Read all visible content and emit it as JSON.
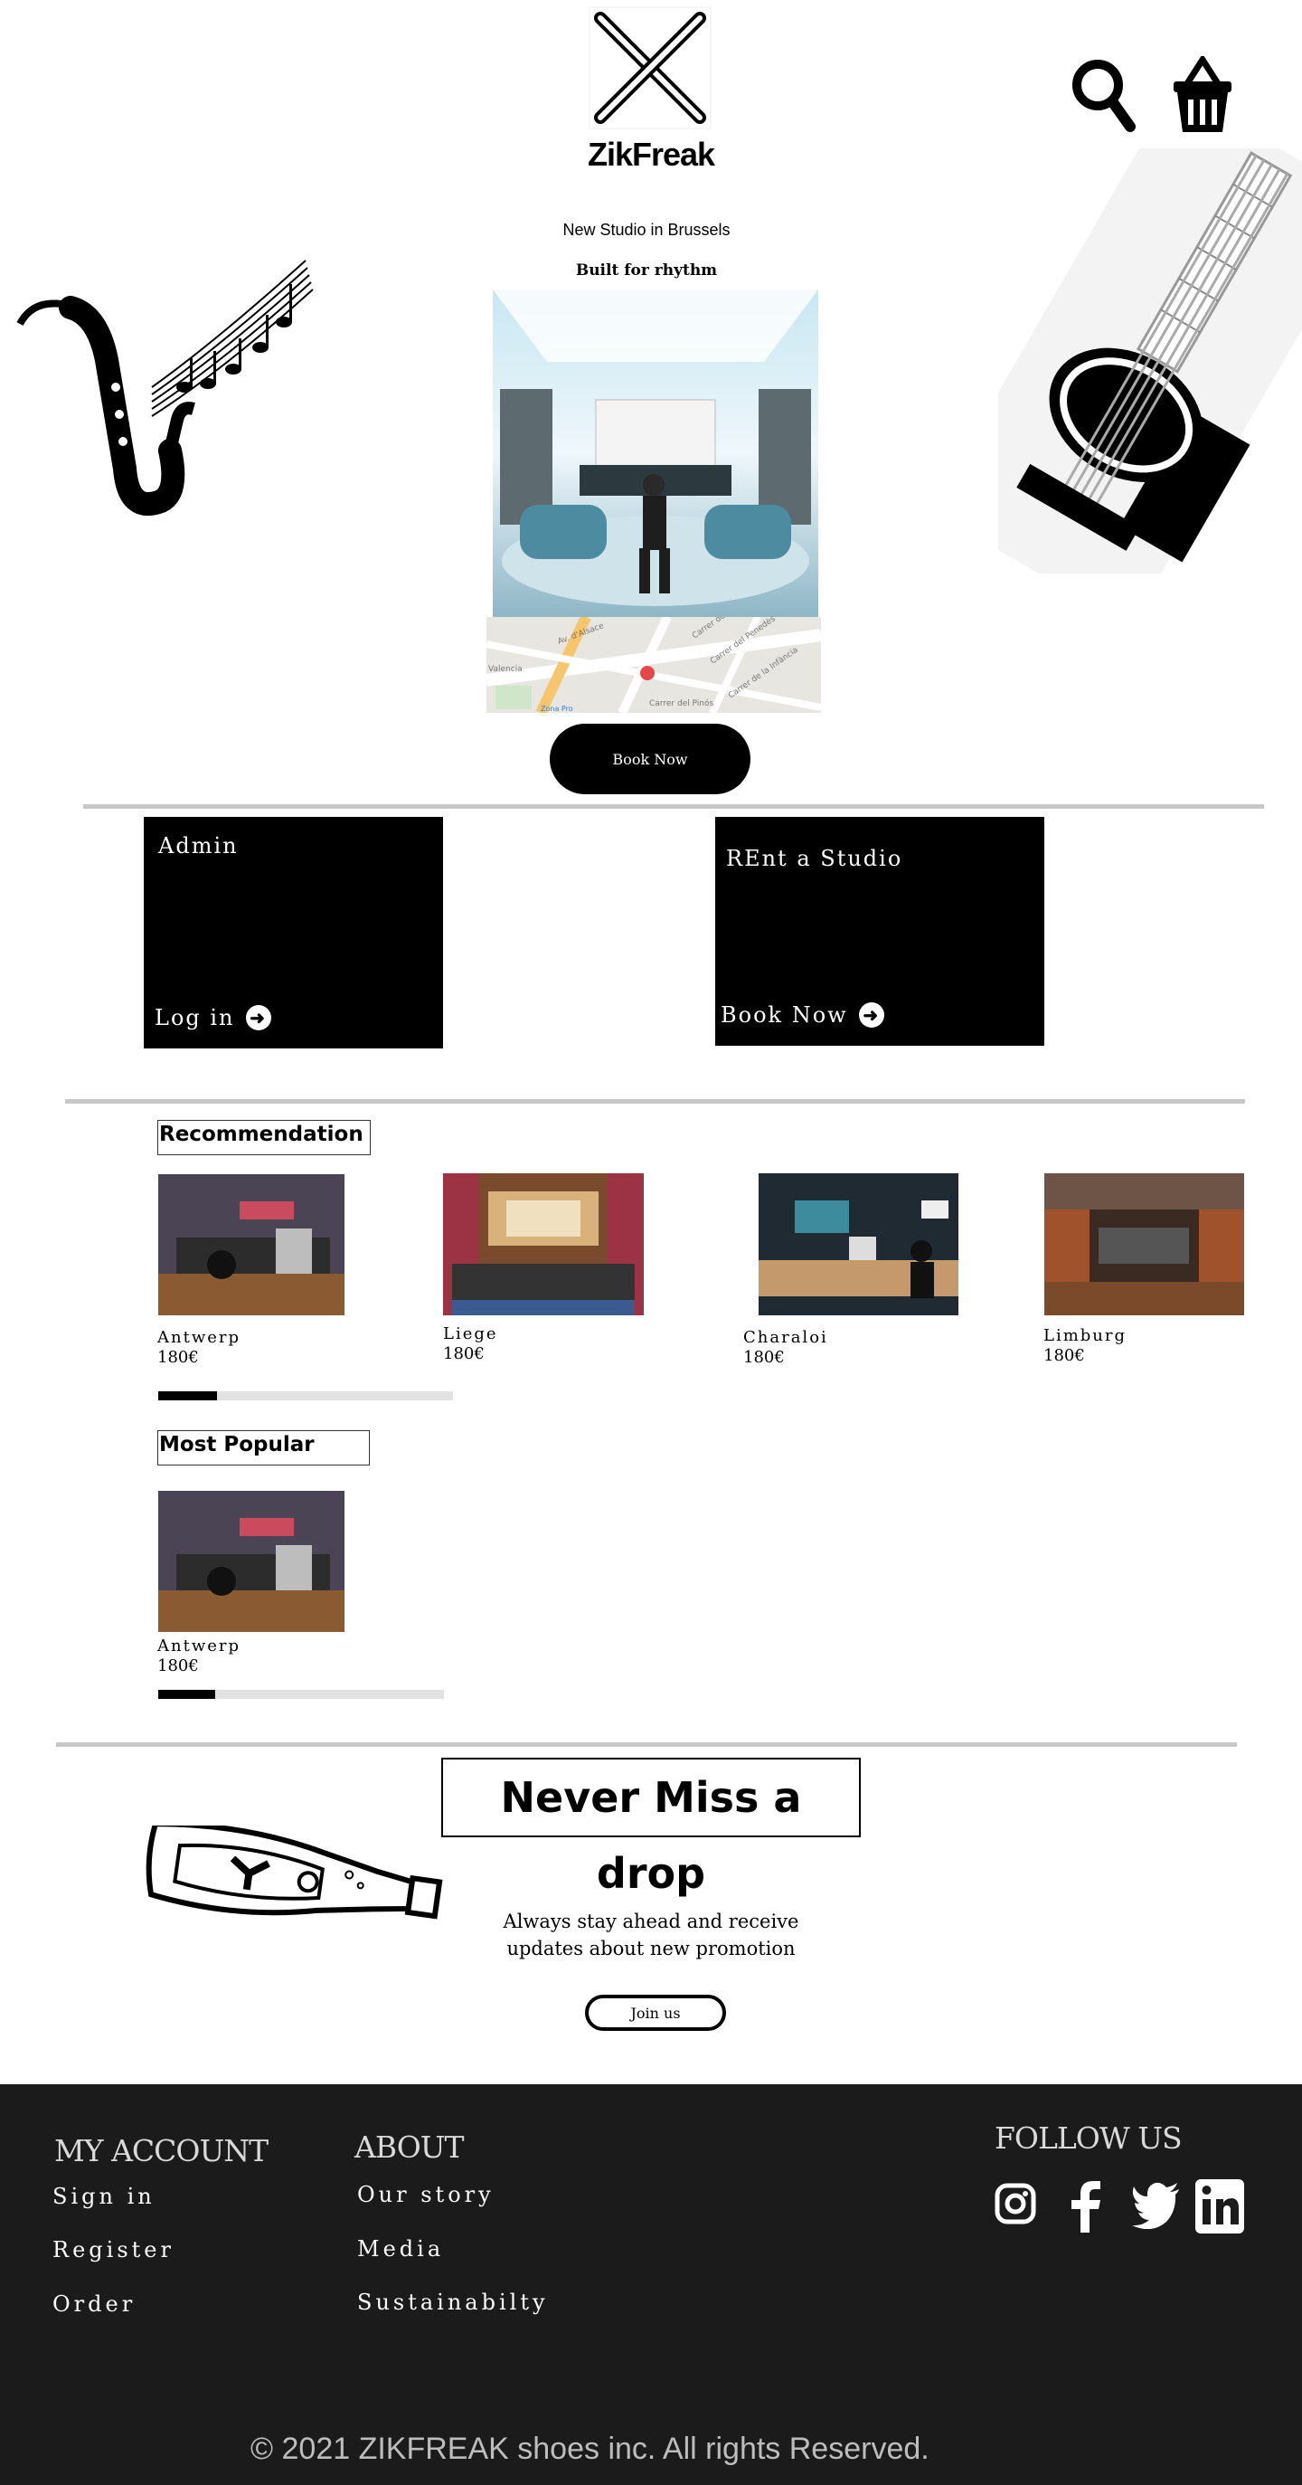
{
  "header": {
    "brand": "ZikFreak",
    "logo_icon": "crossed-drumsticks-icon",
    "search_icon": "search-icon",
    "cart_icon": "basket-icon"
  },
  "hero": {
    "subtitle": "New Studio in Brussels",
    "tagline": "Built for rhythm",
    "book_label": "Book Now",
    "map_labels": [
      "Av. d'Alsace",
      "Carrer de Bolonya",
      "Carrer del Penedès",
      "Carrer de la Infància",
      "Carrer del Pinós",
      "Valencia",
      "Zona Pro"
    ]
  },
  "panels": {
    "admin": {
      "title": "Admin",
      "action": "Log in"
    },
    "rent": {
      "title": "REnt a Studio",
      "action": "Book Now"
    }
  },
  "recommendation": {
    "label": "Recommendation",
    "progress": 0.2,
    "items": [
      {
        "name": "Antwerp",
        "price": "180€"
      },
      {
        "name": "Liege",
        "price": "180€"
      },
      {
        "name": "Charaloi",
        "price": "180€"
      },
      {
        "name": "Limburg",
        "price": "180€"
      }
    ]
  },
  "popular": {
    "label": "Most Popular",
    "progress": 0.2,
    "items": [
      {
        "name": "Antwerp",
        "price": "180€"
      }
    ]
  },
  "newsletter": {
    "title": "Never Miss a drop",
    "line1": "Always stay ahead and receive",
    "line2": "updates about new promotion",
    "button": "Join us"
  },
  "footer": {
    "account": {
      "heading": "MY ACCOUNT",
      "links": [
        "Sign in",
        "Register",
        "Order"
      ]
    },
    "about": {
      "heading": "ABOUT",
      "links": [
        "Our story",
        "Media",
        "Sustainabilty"
      ]
    },
    "follow": {
      "heading": "FOLLOW US",
      "icons": [
        "instagram-icon",
        "facebook-icon",
        "twitter-icon",
        "linkedin-icon"
      ]
    },
    "copyright": "© 2021 ZIKFREAK shoes inc. All rights Reserved."
  },
  "colors": {
    "footer_bg": "#1b1b1b",
    "divider": "#c8c8c8",
    "map_pin": "#e8474a"
  }
}
